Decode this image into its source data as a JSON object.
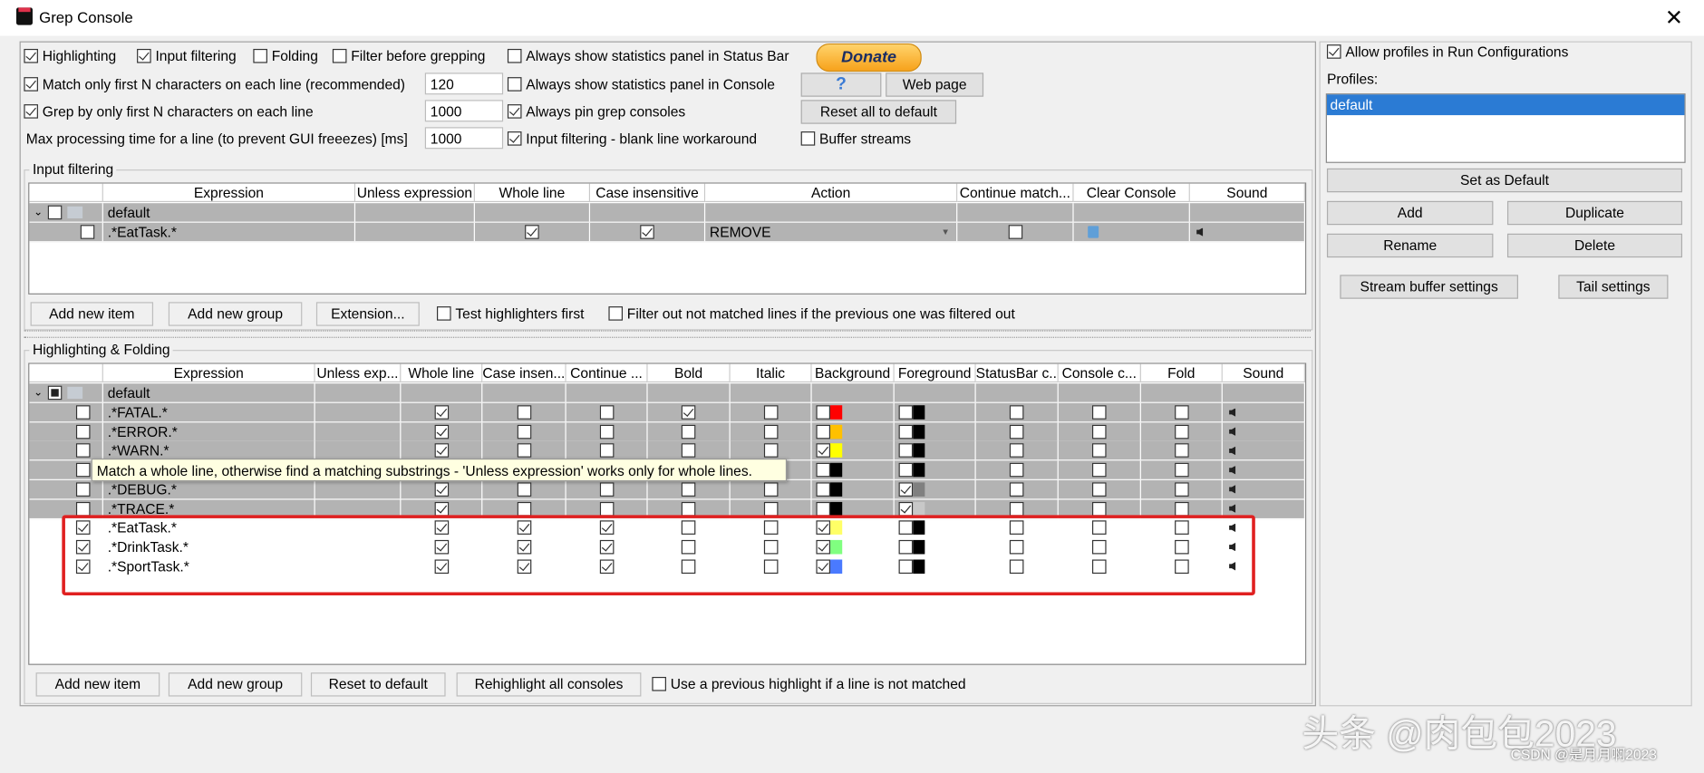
{
  "window": {
    "title": "Grep Console",
    "close_label": "✕"
  },
  "options": {
    "highlighting": {
      "label": "Highlighting",
      "checked": true
    },
    "input_filtering": {
      "label": "Input filtering",
      "checked": true
    },
    "folding": {
      "label": "Folding",
      "checked": false
    },
    "filter_before_grepping": {
      "label": "Filter before grepping",
      "checked": false
    },
    "stats_status_bar": {
      "label": "Always show statistics panel in Status Bar",
      "checked": false
    },
    "match_first_n": {
      "label": "Match only first N characters on each line (recommended)",
      "checked": true,
      "value": "120"
    },
    "stats_console": {
      "label": "Always show statistics panel in Console",
      "checked": false
    },
    "grep_first_n": {
      "label": "Grep by only first N characters on each line",
      "checked": true,
      "value": "1000"
    },
    "pin_consoles": {
      "label": "Always pin grep consoles",
      "checked": true
    },
    "max_time": {
      "label": "Max processing time for a line (to prevent GUI freeezes) [ms]",
      "value": "1000"
    },
    "blank_line": {
      "label": "Input filtering - blank line workaround",
      "checked": true
    },
    "buffer_streams": {
      "label": "Buffer streams",
      "checked": false
    },
    "donate_label": "Donate",
    "help_label": "?",
    "web_page_label": "Web page",
    "reset_all_label": "Reset all to default"
  },
  "input_filtering": {
    "title": "Input filtering",
    "columns": [
      "",
      "Expression",
      "Unless expression",
      "Whole line",
      "Case insensitive",
      "Action",
      "Continue match...",
      "Clear Console",
      "Sound"
    ],
    "group": "default",
    "rows": [
      {
        "enabled": false,
        "expression": ".*EatTask.*",
        "whole_line": true,
        "case_insensitive": true,
        "action": "REMOVE",
        "continue": false
      }
    ],
    "add_item_label": "Add new item",
    "add_group_label": "Add new group",
    "extension_label": "Extension...",
    "test_highlighters": {
      "label": "Test highlighters first",
      "checked": false
    },
    "filter_out": {
      "label": "Filter out not matched lines if the previous one was filtered out",
      "checked": false
    }
  },
  "highlighting": {
    "title": "Highlighting & Folding",
    "columns": [
      "",
      "Expression",
      "Unless exp...",
      "Whole line",
      "Case insen...",
      "Continue ...",
      "Bold",
      "Italic",
      "Background",
      "Foreground",
      "StatusBar c...",
      "Console c...",
      "Fold",
      "Sound"
    ],
    "group": "default",
    "rows": [
      {
        "enabled": false,
        "expression": ".*FATAL.*",
        "whole_line": true,
        "case": false,
        "continue": false,
        "bold": true,
        "italic": false,
        "bg_on": false,
        "bg": "#ff0000",
        "fg_on": false,
        "fg": "#000000",
        "gray": true
      },
      {
        "enabled": false,
        "expression": ".*ERROR.*",
        "whole_line": true,
        "case": false,
        "continue": false,
        "bold": false,
        "italic": false,
        "bg_on": false,
        "bg": "#ffc000",
        "fg_on": false,
        "fg": "#000000",
        "gray": true
      },
      {
        "enabled": false,
        "expression": ".*WARN.*",
        "whole_line": true,
        "case": false,
        "continue": false,
        "bold": false,
        "italic": false,
        "bg_on": true,
        "bg": "#ffff00",
        "fg_on": false,
        "fg": "#000000",
        "gray": true
      },
      {
        "enabled": false,
        "expression": "",
        "whole_line": true,
        "case": false,
        "continue": false,
        "bold": false,
        "italic": false,
        "bg_on": false,
        "bg": "#000000",
        "fg_on": false,
        "fg": "#000000",
        "gray": true
      },
      {
        "enabled": false,
        "expression": ".*DEBUG.*",
        "whole_line": true,
        "case": false,
        "continue": false,
        "bold": false,
        "italic": false,
        "bg_on": false,
        "bg": "#000000",
        "fg_on": true,
        "fg": "#808080",
        "gray": true
      },
      {
        "enabled": false,
        "expression": ".*TRACE.*",
        "whole_line": true,
        "case": false,
        "continue": false,
        "bold": false,
        "italic": false,
        "bg_on": false,
        "bg": "#000000",
        "fg_on": true,
        "fg": "#c8c8c8",
        "gray": true
      },
      {
        "enabled": true,
        "expression": ".*EatTask.*",
        "whole_line": true,
        "case": true,
        "continue": true,
        "bold": false,
        "italic": false,
        "bg_on": true,
        "bg": "#ffff66",
        "fg_on": false,
        "fg": "#000000",
        "gray": false
      },
      {
        "enabled": true,
        "expression": ".*DrinkTask.*",
        "whole_line": true,
        "case": true,
        "continue": true,
        "bold": false,
        "italic": false,
        "bg_on": true,
        "bg": "#80ff80",
        "fg_on": false,
        "fg": "#000000",
        "gray": false
      },
      {
        "enabled": true,
        "expression": ".*SportTask.*",
        "whole_line": true,
        "case": true,
        "continue": true,
        "bold": false,
        "italic": false,
        "bg_on": true,
        "bg": "#4a7aff",
        "fg_on": false,
        "fg": "#000000",
        "gray": false
      }
    ],
    "tooltip": "Match a whole line, otherwise find a matching substrings - 'Unless expression' works only for whole lines.",
    "add_item_label": "Add new item",
    "add_group_label": "Add new group",
    "reset_label": "Reset to default",
    "rehighlight_label": "Rehighlight all consoles",
    "use_previous": {
      "label": "Use a previous highlight if a line is not matched",
      "checked": false
    },
    "highlight_color": "#e02020"
  },
  "profiles": {
    "allow": {
      "label": "Allow profiles in Run Configurations",
      "checked": true
    },
    "label": "Profiles:",
    "items": [
      "default"
    ],
    "set_default_label": "Set as Default",
    "add_label": "Add",
    "duplicate_label": "Duplicate",
    "rename_label": "Rename",
    "delete_label": "Delete",
    "stream_buffer_label": "Stream buffer settings",
    "tail_label": "Tail settings"
  },
  "watermark": {
    "main": "头条 @肉包包2023",
    "csdn": "CSDN @是月月啊2023"
  }
}
